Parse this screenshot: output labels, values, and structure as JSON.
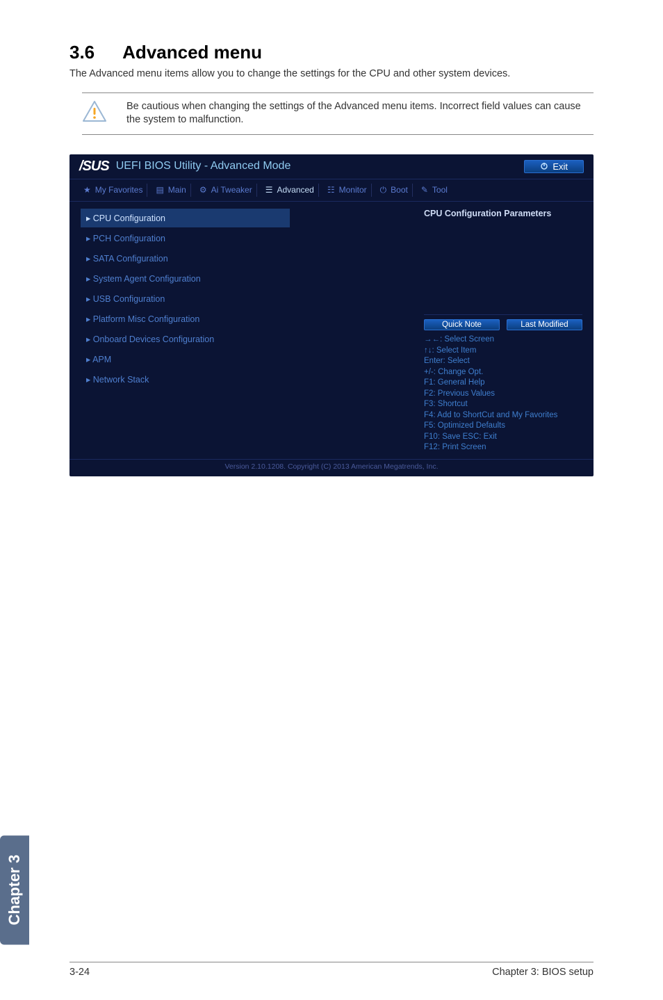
{
  "section": {
    "number": "3.6",
    "title": "Advanced menu",
    "description": "The Advanced menu items allow you to change the settings for the CPU and other system devices.",
    "note": "Be cautious when changing the settings of the Advanced menu items. Incorrect field values can cause the system to malfunction."
  },
  "bios": {
    "brand": "/SUS",
    "title": "UEFI BIOS Utility - Advanced Mode",
    "exit_label": "Exit",
    "tabs": {
      "favorites": "My Favorites",
      "main": "Main",
      "tweaker": "Ai Tweaker",
      "advanced": "Advanced",
      "monitor": "Monitor",
      "boot": "Boot",
      "tool": "Tool"
    },
    "items": {
      "cpu": "CPU Configuration",
      "pch": "PCH Configuration",
      "sata": "SATA Configuration",
      "sa": "System Agent Configuration",
      "usb": "USB Configuration",
      "misc": "Platform Misc Configuration",
      "onboard": "Onboard Devices Configuration",
      "apm": "APM",
      "net": "Network Stack"
    },
    "help_title": "CPU Configuration Parameters",
    "quick_note": "Quick Note",
    "last_modified": "Last Modified",
    "keyhelp": {
      "k0": "→←: Select Screen",
      "k1": "↑↓: Select Item",
      "k2": "Enter: Select",
      "k3": "+/-: Change Opt.",
      "k4": "F1: General Help",
      "k5": "F2: Previous Values",
      "k6": "F3: Shortcut",
      "k7": "F4: Add to ShortCut and My Favorites",
      "k8": "F5: Optimized Defaults",
      "k9": "F10: Save  ESC: Exit",
      "k10": "F12: Print Screen"
    },
    "footer": "Version 2.10.1208. Copyright (C) 2013 American Megatrends, Inc."
  },
  "side_tab": "Chapter 3",
  "page_footer": {
    "left": "3-24",
    "right": "Chapter 3: BIOS setup"
  }
}
